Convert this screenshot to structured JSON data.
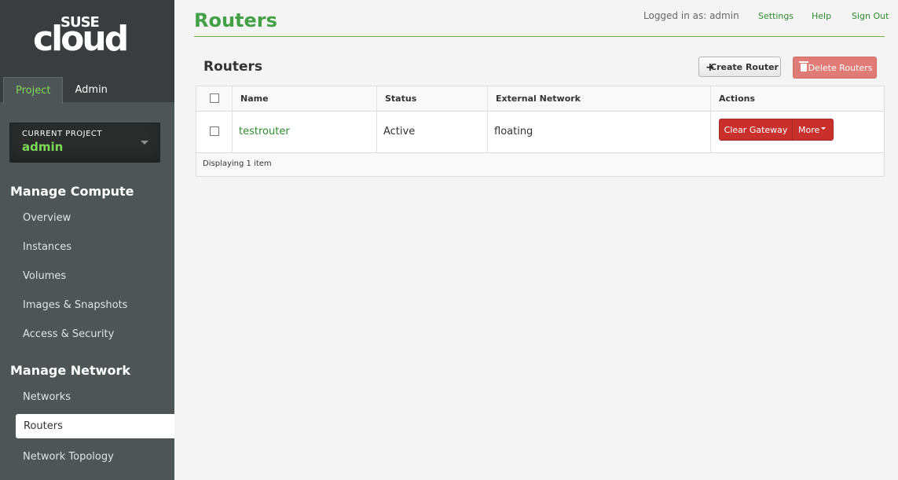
{
  "brand": {
    "top": "SUSE",
    "main": "cloud"
  },
  "sidebar": {
    "tabs": [
      {
        "label": "Project",
        "active": true
      },
      {
        "label": "Admin",
        "active": false
      }
    ],
    "current_project": {
      "label": "CURRENT PROJECT",
      "name": "admin"
    },
    "sections": [
      {
        "heading": "Manage Compute",
        "items": [
          "Overview",
          "Instances",
          "Volumes",
          "Images & Snapshots",
          "Access & Security"
        ]
      },
      {
        "heading": "Manage Network",
        "items": [
          "Networks",
          "Routers",
          "Network Topology"
        ]
      }
    ],
    "active_item": "Routers"
  },
  "header": {
    "title": "Routers",
    "logged_in": "Logged in as: admin",
    "links": [
      "Settings",
      "Help",
      "Sign Out"
    ]
  },
  "table": {
    "title": "Routers",
    "create_label": "Create Router",
    "delete_label": "Delete Routers",
    "columns": [
      "Name",
      "Status",
      "External Network",
      "Actions"
    ],
    "rows": [
      {
        "name": "testrouter",
        "status": "Active",
        "external_network": "floating",
        "action_primary": "Clear Gateway",
        "action_more": "More"
      }
    ],
    "footer": "Displaying 1 item"
  },
  "colors": {
    "accent_green": "#43a047",
    "sidebar_bg": "#4d5556",
    "danger": "#c9302c",
    "danger_light": "#e07b75"
  }
}
